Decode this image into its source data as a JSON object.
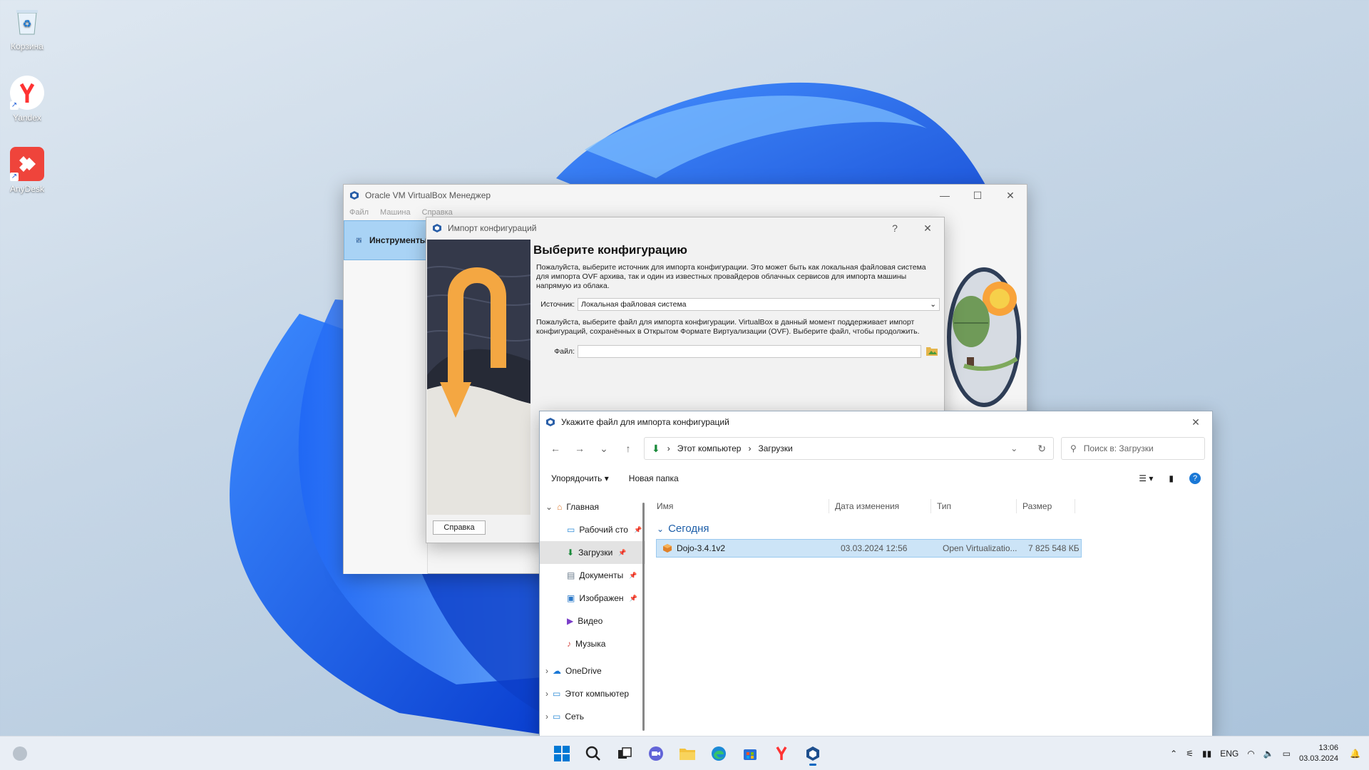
{
  "desktop": {
    "icons": [
      {
        "label": "Корзина",
        "icon": "recycle-bin-icon"
      },
      {
        "label": "Yandex",
        "icon": "yandex-browser-icon"
      },
      {
        "label": "AnyDesk",
        "icon": "anydesk-icon"
      }
    ]
  },
  "vbox_main": {
    "title": "Oracle VM VirtualBox Менеджер",
    "menu": [
      "Файл",
      "Машина",
      "Справка"
    ],
    "tools_label": "Инструменты"
  },
  "import_dialog": {
    "title": "Импорт конфигураций",
    "help_glyph": "?",
    "heading": "Выберите конфигурацию",
    "intro": "Пожалуйста, выберите источник для импорта конфигурации. Это может быть как локальная файловая система для импорта OVF архива, так и один из известных провайдеров облачных сервисов для импорта машины напрямую из облака.",
    "source_label": "Источник:",
    "source_value": "Локальная файловая система",
    "file_intro": "Пожалуйста, выберите файл для импорта конфигурации. VirtualBox в данный момент поддерживает импорт конфигураций, сохранённых в Открытом Формате Виртуализации (OVF). Выберите файл, чтобы продолжить.",
    "file_label": "Файл:",
    "file_value": "",
    "help_button": "Справка"
  },
  "file_dialog": {
    "title": "Укажите файл для импорта конфигураций",
    "breadcrumb": [
      "Этот компьютер",
      "Загрузки"
    ],
    "search_placeholder": "Поиск в: Загрузки",
    "organize": "Упорядочить",
    "new_folder": "Новая папка",
    "nav": [
      {
        "label": "Главная",
        "icon": "home-icon",
        "pinned": false
      },
      {
        "label": "Рабочий сто",
        "icon": "desktop-folder-icon",
        "pinned": true
      },
      {
        "label": "Загрузки",
        "icon": "downloads-icon",
        "pinned": true,
        "selected": true
      },
      {
        "label": "Документы",
        "icon": "documents-icon",
        "pinned": true
      },
      {
        "label": "Изображен",
        "icon": "pictures-icon",
        "pinned": true
      },
      {
        "label": "Видео",
        "icon": "videos-icon",
        "pinned": false
      },
      {
        "label": "Музыка",
        "icon": "music-icon",
        "pinned": false
      },
      {
        "label": "OneDrive",
        "icon": "onedrive-icon",
        "pinned": false
      },
      {
        "label": "Этот компьютер",
        "icon": "this-pc-icon",
        "pinned": false
      },
      {
        "label": "Сеть",
        "icon": "network-icon",
        "pinned": false
      }
    ],
    "columns": [
      "Имя",
      "Дата изменения",
      "Тип",
      "Размер"
    ],
    "group": "Сегодня",
    "files": [
      {
        "name": "Dojo-3.4.1v2",
        "date": "03.03.2024 12:56",
        "type": "Open Virtualizatio...",
        "size": "7 825 548 КБ"
      }
    ]
  },
  "taskbar": {
    "lang": "ENG",
    "time": "13:06",
    "date": "03.03.2024"
  },
  "colors": {
    "accent": "#0067c0",
    "selection": "#cce4f7",
    "vbox_tools": "#a9d3f5"
  }
}
